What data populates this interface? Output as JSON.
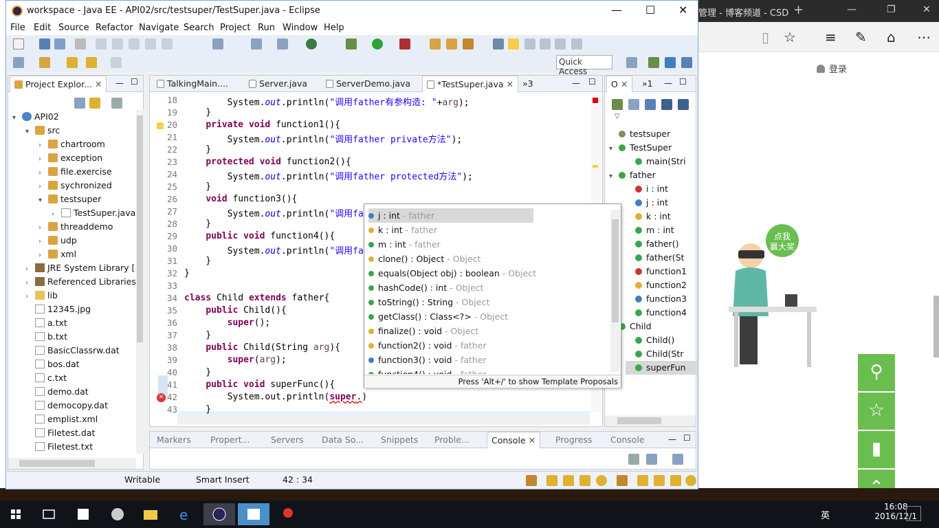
{
  "browser": {
    "tab_title": "管理 - 博客频道 - CSD",
    "login": "登录",
    "promo_badge_line1": "点我",
    "promo_badge_line2": "赢大奖"
  },
  "window": {
    "title": "workspace - Java EE - API02/src/testsuper/TestSuper.java - Eclipse"
  },
  "menu": [
    "File",
    "Edit",
    "Source",
    "Refactor",
    "Navigate",
    "Search",
    "Project",
    "Run",
    "Window",
    "Help"
  ],
  "quick_access": "Quick Access",
  "explorer": {
    "tab": "Project Explor...",
    "items": [
      {
        "label": "API02",
        "level": 0,
        "arrow": "▾",
        "icon": "jav"
      },
      {
        "label": "src",
        "level": 1,
        "arrow": "▾",
        "icon": "pkg"
      },
      {
        "label": "chartroom",
        "level": 2,
        "arrow": "›",
        "icon": "pkg"
      },
      {
        "label": "exception",
        "level": 2,
        "arrow": "›",
        "icon": "pkg"
      },
      {
        "label": "file.exercise",
        "level": 2,
        "arrow": "›",
        "icon": "pkg"
      },
      {
        "label": "sychronized",
        "level": 2,
        "arrow": "›",
        "icon": "pkg"
      },
      {
        "label": "testsuper",
        "level": 2,
        "arrow": "▾",
        "icon": "pkg"
      },
      {
        "label": "TestSuper.java",
        "level": 3,
        "arrow": "›",
        "icon": "file"
      },
      {
        "label": "threaddemo",
        "level": 2,
        "arrow": "›",
        "icon": "pkg"
      },
      {
        "label": "udp",
        "level": 2,
        "arrow": "›",
        "icon": "pkg"
      },
      {
        "label": "xml",
        "level": 2,
        "arrow": "›",
        "icon": "pkg"
      },
      {
        "label": "JRE System Library [",
        "level": 1,
        "arrow": "›",
        "icon": "lib"
      },
      {
        "label": "Referenced Libraries",
        "level": 1,
        "arrow": "›",
        "icon": "lib"
      },
      {
        "label": "lib",
        "level": 1,
        "arrow": "›",
        "icon": "fold"
      },
      {
        "label": "12345.jpg",
        "level": 1,
        "arrow": "",
        "icon": "file"
      },
      {
        "label": "a.txt",
        "level": 1,
        "arrow": "",
        "icon": "file"
      },
      {
        "label": "b.txt",
        "level": 1,
        "arrow": "",
        "icon": "file"
      },
      {
        "label": "BasicClassrw.dat",
        "level": 1,
        "arrow": "",
        "icon": "file"
      },
      {
        "label": "bos.dat",
        "level": 1,
        "arrow": "",
        "icon": "file"
      },
      {
        "label": "c.txt",
        "level": 1,
        "arrow": "",
        "icon": "file"
      },
      {
        "label": "demo.dat",
        "level": 1,
        "arrow": "",
        "icon": "file"
      },
      {
        "label": "democopy.dat",
        "level": 1,
        "arrow": "",
        "icon": "file"
      },
      {
        "label": "emplist.xml",
        "level": 1,
        "arrow": "",
        "icon": "file"
      },
      {
        "label": "Filetest.dat",
        "level": 1,
        "arrow": "",
        "icon": "file"
      },
      {
        "label": "Filetest.txt",
        "level": 1,
        "arrow": "",
        "icon": "file"
      }
    ]
  },
  "editor": {
    "tabs": [
      "TalkingMain....",
      "Server.java",
      "ServerDemo.java",
      "*TestSuper.java",
      "»3"
    ],
    "lines": [
      {
        "n": "18",
        "html": "        System.<i class=\"it\">out</i>.println(<span class=\"st\">\"调用father有参构造: \"</span>+<span class=\"vr\">arg</span>);"
      },
      {
        "n": "19",
        "html": "    }"
      },
      {
        "n": "20",
        "html": "    <span class=\"kw\">private</span> <span class=\"kw\">void</span> function1(){"
      },
      {
        "n": "21",
        "html": "        System.<i class=\"it\">out</i>.println(<span class=\"st\">\"调用father private方法\"</span>);"
      },
      {
        "n": "22",
        "html": "    }"
      },
      {
        "n": "23",
        "html": "    <span class=\"kw\">protected</span> <span class=\"kw\">void</span> function2(){"
      },
      {
        "n": "24",
        "html": "        System.<i class=\"it\">out</i>.println(<span class=\"st\">\"调用father protected方法\"</span>);"
      },
      {
        "n": "25",
        "html": "    }"
      },
      {
        "n": "26",
        "html": "    <span class=\"kw\">void</span> function3(){"
      },
      {
        "n": "27",
        "html": "        System.<i class=\"it\">out</i>.println(<span class=\"st\">\"调用fat</span>"
      },
      {
        "n": "28",
        "html": "    }"
      },
      {
        "n": "29",
        "html": "    <span class=\"kw\">public</span> <span class=\"kw\">void</span> function4(){"
      },
      {
        "n": "30",
        "html": "        System.<i class=\"it\">out</i>.println(<span class=\"st\">\"调用fat</span>"
      },
      {
        "n": "31",
        "html": "    }"
      },
      {
        "n": "32",
        "html": "}"
      },
      {
        "n": "33",
        "html": ""
      },
      {
        "n": "34",
        "html": "<span class=\"kw\">class</span> Child <span class=\"kw\">extends</span> father{"
      },
      {
        "n": "35",
        "html": "    <span class=\"kw\">public</span> Child(){"
      },
      {
        "n": "36",
        "html": "        <span class=\"kw\">super</span>();"
      },
      {
        "n": "37",
        "html": "    }"
      },
      {
        "n": "38",
        "html": "    <span class=\"kw\">public</span> Child(String <span class=\"vr\">arg</span>){"
      },
      {
        "n": "39",
        "html": "        <span class=\"kw\">super</span>(<span class=\"vr\">arg</span>);"
      },
      {
        "n": "40",
        "html": "    }"
      },
      {
        "n": "41",
        "html": "    <span class=\"kw\">public</span> <span class=\"kw\">void</span> superFunc(){"
      },
      {
        "n": "42",
        "html": "        System.out.println(<span style=\"text-decoration:underline wavy #d00\"><span class=\"kw\">super</span>.</span>)"
      },
      {
        "n": "43",
        "html": "    }"
      }
    ]
  },
  "assist": {
    "items": [
      {
        "t": "j : int",
        "q": " - father",
        "c": "#3f7fbf"
      },
      {
        "t": "k : int",
        "q": " - father",
        "c": "#e0b030"
      },
      {
        "t": "m : int",
        "q": " - father",
        "c": "#3aa64a"
      },
      {
        "t": "clone() : Object",
        "q": " - Object",
        "c": "#e0b030"
      },
      {
        "t": "equals(Object obj) : boolean",
        "q": " - Object",
        "c": "#3aa64a"
      },
      {
        "t": "hashCode() : int",
        "q": " - Object",
        "c": "#3aa64a"
      },
      {
        "t": "toString() : String",
        "q": " - Object",
        "c": "#3aa64a"
      },
      {
        "t": "getClass() : Class<?>",
        "q": " - Object",
        "c": "#3aa64a"
      },
      {
        "t": "finalize() : void",
        "q": " - Object",
        "c": "#e0b030"
      },
      {
        "t": "function2() : void",
        "q": " - father",
        "c": "#e0b030"
      },
      {
        "t": "function3() : void",
        "q": " - father",
        "c": "#3f7fbf"
      },
      {
        "t": "function4() : void",
        "q": " - father",
        "c": "#3aa64a"
      }
    ],
    "footer": "Press 'Alt+/' to show Template Proposals"
  },
  "outline": {
    "tab": "O",
    "tab2": "»1",
    "items": [
      {
        "label": "testsuper",
        "indent": 0,
        "c": "#8a8a5a"
      },
      {
        "label": "TestSuper",
        "indent": 0,
        "arrow": "▾",
        "c": "#3aa64a"
      },
      {
        "label": "main(Stri",
        "indent": 1,
        "c": "#3aa64a"
      },
      {
        "label": "father",
        "indent": 0,
        "arrow": "▾",
        "c": "#3aa64a"
      },
      {
        "label": "i : int",
        "indent": 1,
        "c": "#cc3333"
      },
      {
        "label": "j : int",
        "indent": 1,
        "c": "#3f7fbf"
      },
      {
        "label": "k : int",
        "indent": 1,
        "c": "#e0b030"
      },
      {
        "label": "m : int",
        "indent": 1,
        "c": "#3aa64a"
      },
      {
        "label": "father()",
        "indent": 1,
        "c": "#3aa64a"
      },
      {
        "label": "father(St",
        "indent": 1,
        "c": "#3aa64a"
      },
      {
        "label": "function1",
        "indent": 1,
        "c": "#cc3333"
      },
      {
        "label": "function2",
        "indent": 1,
        "c": "#e0b030"
      },
      {
        "label": "function3",
        "indent": 1,
        "c": "#3f7fbf"
      },
      {
        "label": "function4",
        "indent": 1,
        "c": "#3aa64a"
      },
      {
        "label": "Child",
        "indent": 0,
        "c": "#3aa64a"
      },
      {
        "label": "Child()",
        "indent": 1,
        "c": "#3aa64a"
      },
      {
        "label": "Child(Str",
        "indent": 1,
        "c": "#3aa64a"
      },
      {
        "label": "superFun",
        "indent": 1,
        "c": "#3aa64a"
      }
    ]
  },
  "bottom_tabs": [
    "Markers",
    "Propert...",
    "Servers",
    "Data So...",
    "Snippets",
    "Proble...",
    "Console",
    "Progress",
    "Console"
  ],
  "status": {
    "writable": "Writable",
    "insert": "Smart Insert",
    "position": "42 : 34"
  },
  "taskbar": {
    "time": "16:08",
    "date": "2016/12/1",
    "ime": "英"
  }
}
